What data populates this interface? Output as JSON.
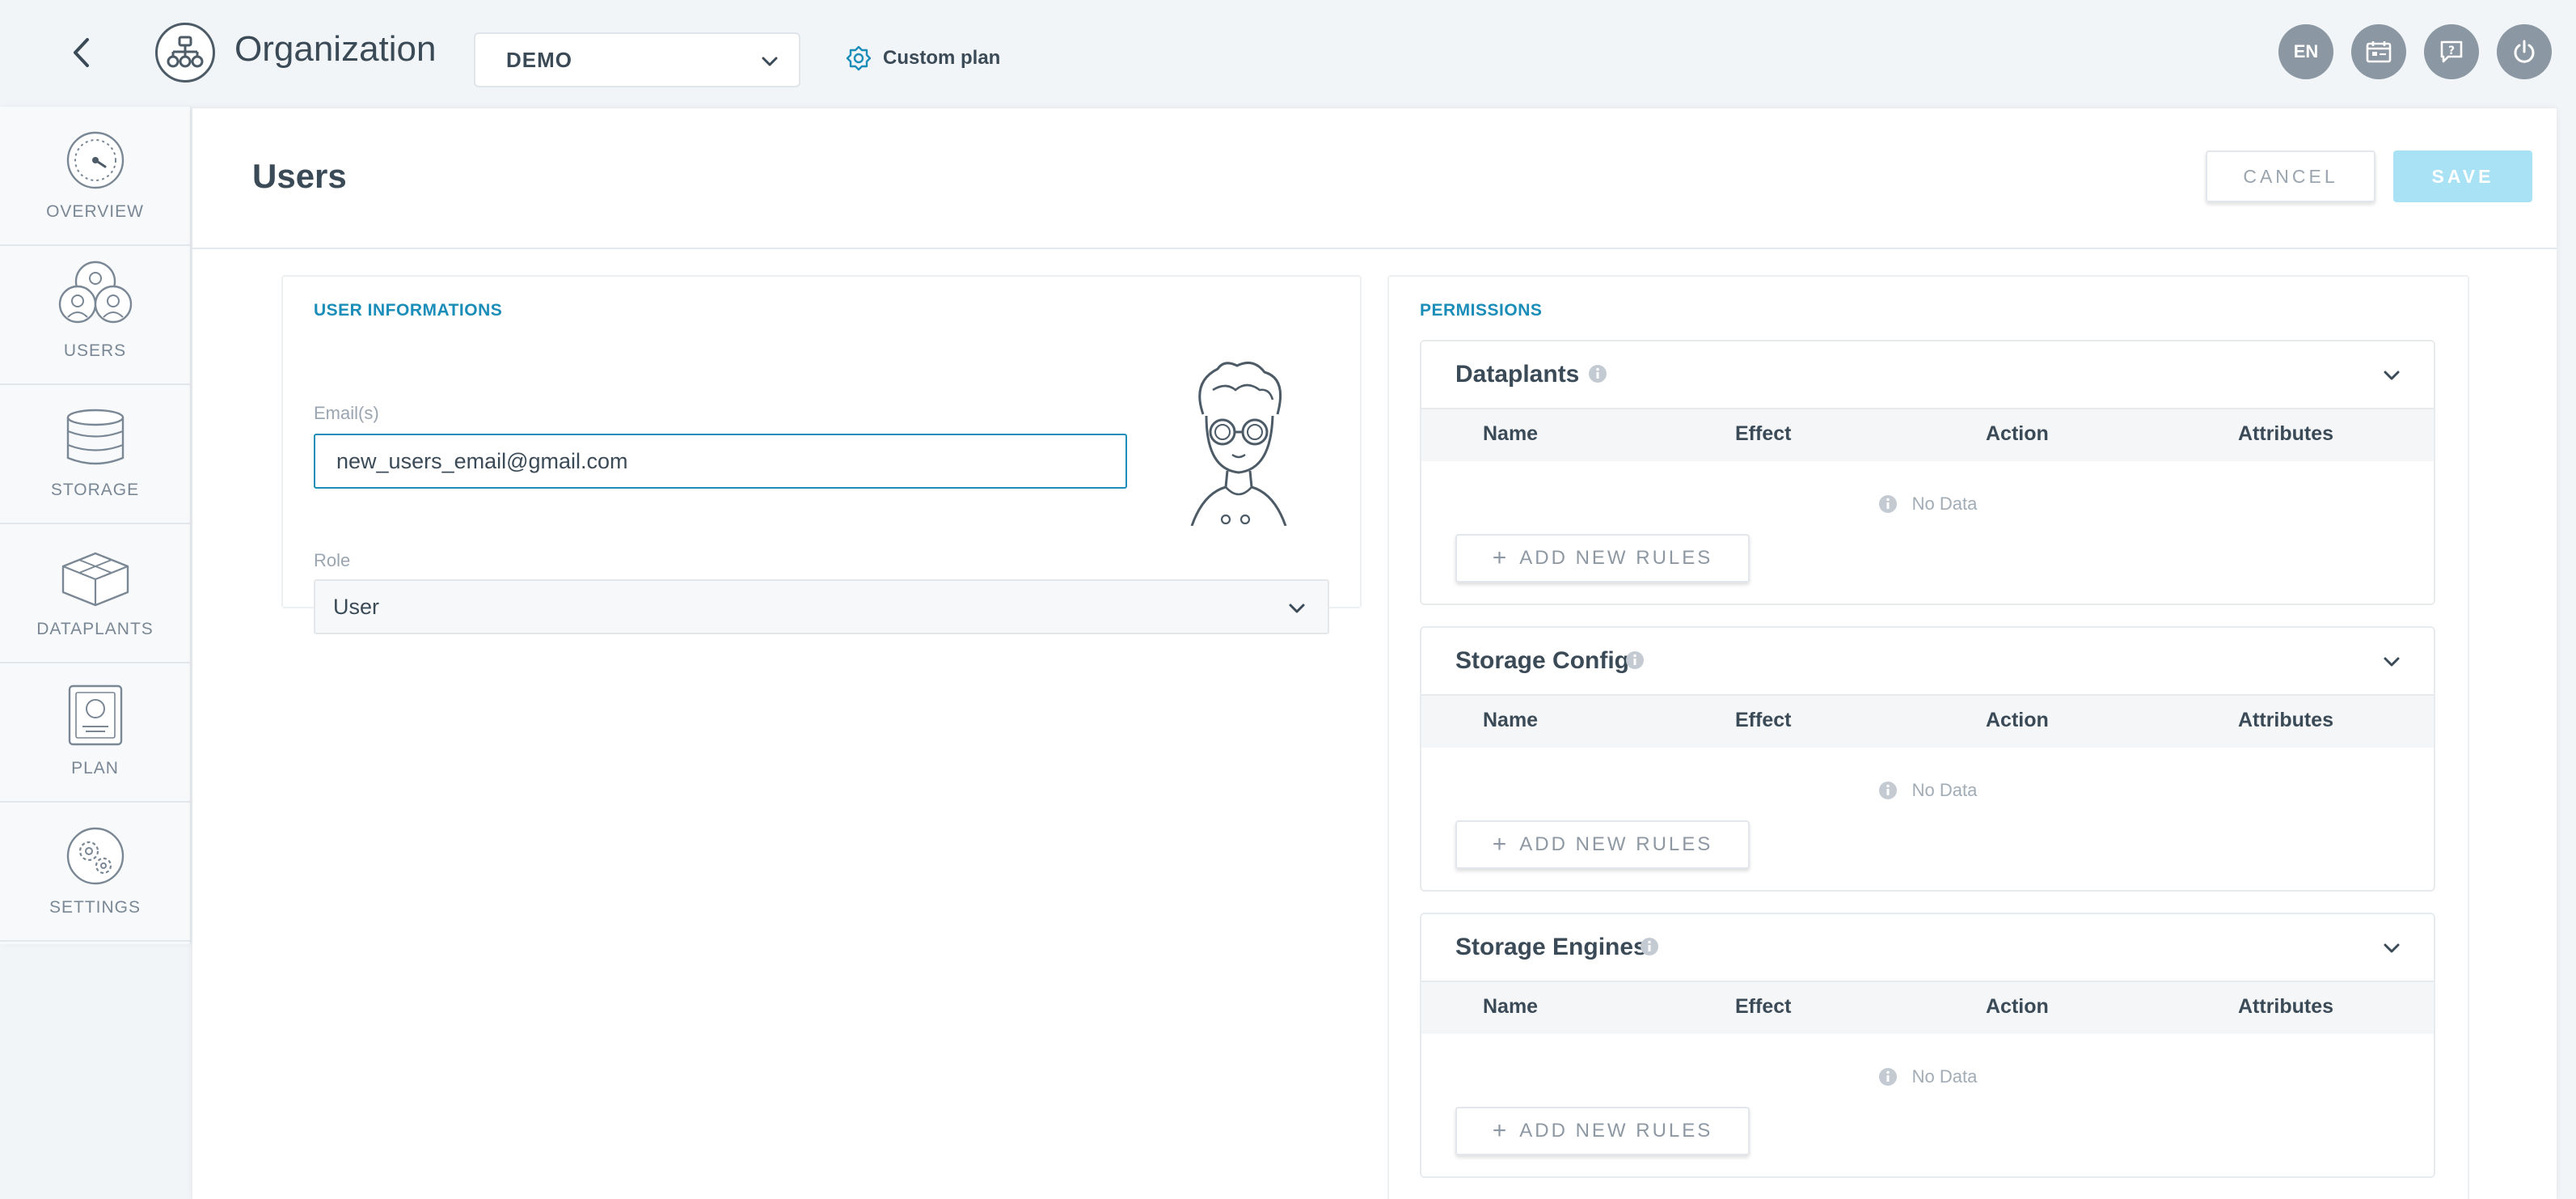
{
  "app": {
    "title": "Organization",
    "environment": "DEMO",
    "plan_label": "Custom plan",
    "language": "EN"
  },
  "icons": {
    "back": "chevron-left-icon",
    "org": "organization-icon",
    "plan": "gear-plan-icon",
    "calendar": "calendar-icon",
    "help": "help-icon",
    "power": "power-icon",
    "info": "info-icon",
    "chevron": "chevron-down-icon"
  },
  "sidebar": {
    "items": [
      {
        "label": "OVERVIEW",
        "icon": "dashboard-gauge-icon"
      },
      {
        "label": "USERS",
        "icon": "users-group-icon"
      },
      {
        "label": "STORAGE",
        "icon": "database-icon"
      },
      {
        "label": "DATAPLANTS",
        "icon": "boxes-icon"
      },
      {
        "label": "PLAN",
        "icon": "plan-document-icon"
      },
      {
        "label": "SETTINGS",
        "icon": "settings-gears-icon"
      }
    ]
  },
  "page": {
    "title": "Users",
    "cancel_label": "CANCEL",
    "save_label": "SAVE"
  },
  "user_info": {
    "section_title": "USER INFORMATIONS",
    "email_label": "Email(s)",
    "email_value": "new_users_email@gmail.com",
    "role_label": "Role",
    "role_value": "User"
  },
  "permissions": {
    "section_title": "PERMISSIONS",
    "columns": [
      "Name",
      "Effect",
      "Action",
      "Attributes"
    ],
    "no_data": "No Data",
    "add_label": "ADD NEW RULES",
    "sections": [
      {
        "name": "Dataplants"
      },
      {
        "name": "Storage Config"
      },
      {
        "name": "Storage Engines"
      }
    ]
  },
  "colors": {
    "accent": "#1a8db9",
    "save_disabled": "#a9e2f4",
    "sidebar_bg": "#f7f9fb",
    "page_bg": "#f2f5f8"
  }
}
